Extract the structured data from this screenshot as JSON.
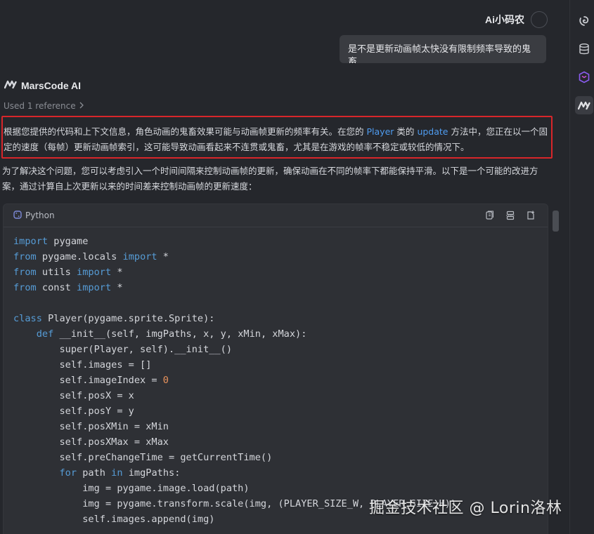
{
  "header": {
    "username": "Ai小码农"
  },
  "user_message": "是不是更新动画帧太快没有限制频率导致的鬼畜",
  "assistant": {
    "name": "MarsCode AI",
    "used_reference": "Used 1 reference",
    "para1": {
      "t1": "根据您提供的代码和上下文信息，角色动画的鬼畜效果可能与动画帧更新的频率有关。在您的",
      "class_name": "Player",
      "t2": "类的",
      "method_name": "update",
      "t3": "方法中，您正在以一个固定的速度（每帧）更新动画帧索引，这可能导致动画看起来不连贯或鬼畜，尤其是在游戏的帧率不稳定或较低的情况下。"
    },
    "para2": "为了解决这个问题，您可以考虑引入一个时间间隔来控制动画帧的更新，确保动画在不同的帧率下都能保持平滑。以下是一个可能的改进方案，通过计算自上次更新以来的时间差来控制动画帧的更新速度："
  },
  "code_block": {
    "language": "Python",
    "lines": [
      [
        [
          "kw",
          "import"
        ],
        [
          "t",
          " pygame"
        ]
      ],
      [
        [
          "kw",
          "from"
        ],
        [
          "t",
          " pygame.locals "
        ],
        [
          "kw",
          "import"
        ],
        [
          "t",
          " *"
        ]
      ],
      [
        [
          "kw",
          "from"
        ],
        [
          "t",
          " utils "
        ],
        [
          "kw",
          "import"
        ],
        [
          "t",
          " *"
        ]
      ],
      [
        [
          "kw",
          "from"
        ],
        [
          "t",
          " const "
        ],
        [
          "kw",
          "import"
        ],
        [
          "t",
          " *"
        ]
      ],
      [],
      [
        [
          "kw",
          "class"
        ],
        [
          "t",
          " Player(pygame.sprite.Sprite):"
        ]
      ],
      [
        [
          "t",
          "    "
        ],
        [
          "kw",
          "def"
        ],
        [
          "t",
          " __init__(self, imgPaths, x, y, xMin, xMax):"
        ]
      ],
      [
        [
          "t",
          "        super(Player, self).__init__()"
        ]
      ],
      [
        [
          "t",
          "        self.images = []"
        ]
      ],
      [
        [
          "t",
          "        self.imageIndex = "
        ],
        [
          "num",
          "0"
        ]
      ],
      [
        [
          "t",
          "        self.posX = x"
        ]
      ],
      [
        [
          "t",
          "        self.posY = y"
        ]
      ],
      [
        [
          "t",
          "        self.posXMin = xMin"
        ]
      ],
      [
        [
          "t",
          "        self.posXMax = xMax"
        ]
      ],
      [
        [
          "t",
          "        self.preChangeTime = getCurrentTime()"
        ]
      ],
      [
        [
          "t",
          "        "
        ],
        [
          "kw",
          "for"
        ],
        [
          "t",
          " path "
        ],
        [
          "kw",
          "in"
        ],
        [
          "t",
          " imgPaths:"
        ]
      ],
      [
        [
          "t",
          "            img = pygame.image.load(path)"
        ]
      ],
      [
        [
          "t",
          "            img = pygame.transform.scale(img, (PLAYER_SIZE_W, PLAYER_SIZE_H))"
        ]
      ],
      [
        [
          "t",
          "            self.images.append(img)"
        ]
      ]
    ]
  },
  "watermark": "掘金技术社区 @ Lorin洛林",
  "colors": {
    "background": "#25272c",
    "code_background": "#2e3035",
    "keyword": "#569cd6",
    "number": "#e8925c",
    "link": "#4f9cf0",
    "highlight_border": "#d8262a"
  },
  "icons": {
    "right_bar": [
      "marscode-swirl-icon",
      "database-icon",
      "cube-icon",
      "marscode-logo-icon"
    ],
    "code_tools": [
      "copy-icon",
      "insert-icon",
      "new-file-icon"
    ]
  }
}
